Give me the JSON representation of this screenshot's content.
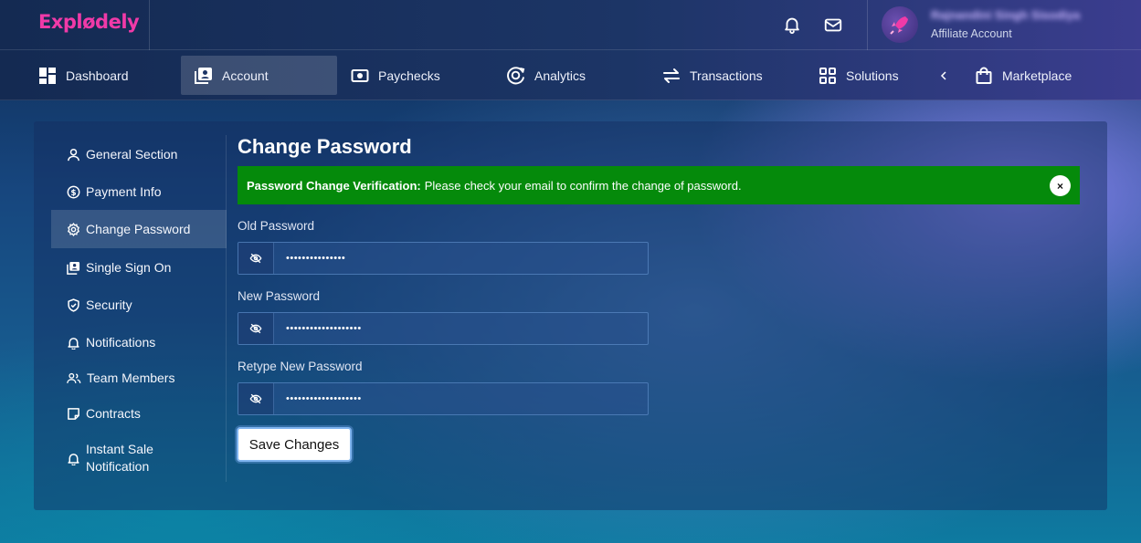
{
  "header": {
    "logo": "Explødely",
    "user_name": "Rajnandini Singh Sisodiya",
    "user_role": "Affiliate Account",
    "icons": [
      "bell-icon",
      "mail-icon",
      "rocket-avatar"
    ]
  },
  "nav": {
    "items": [
      {
        "label": "Dashboard",
        "icon": "dashboard-icon"
      },
      {
        "label": "Account",
        "icon": "account-icon",
        "active": true
      },
      {
        "label": "Paychecks",
        "icon": "paychecks-icon"
      },
      {
        "label": "Analytics",
        "icon": "analytics-icon"
      },
      {
        "label": "Transactions",
        "icon": "transactions-icon"
      },
      {
        "label": "Solutions",
        "icon": "solutions-icon"
      },
      {
        "label": "Marketplace",
        "icon": "marketplace-icon"
      }
    ],
    "back_icon": "chevron-left-icon"
  },
  "sidebar": {
    "items": [
      {
        "label": "General Section",
        "icon": "user-icon"
      },
      {
        "label": "Payment Info",
        "icon": "dollar-circle-icon"
      },
      {
        "label": "Change Password",
        "icon": "gear-icon",
        "active": true
      },
      {
        "label": "Single Sign On",
        "icon": "id-card-icon"
      },
      {
        "label": "Security",
        "icon": "shield-icon"
      },
      {
        "label": "Notifications",
        "icon": "bell-icon"
      },
      {
        "label": "Team Members",
        "icon": "team-icon"
      },
      {
        "label": "Contracts",
        "icon": "note-icon"
      },
      {
        "label": "Instant Sale Notification",
        "label_line1": "Instant Sale",
        "label_line2": "Notification",
        "icon": "bell-icon"
      }
    ]
  },
  "main": {
    "title": "Change Password",
    "alert": {
      "title": "Password Change Verification:",
      "message": "Please check your email to confirm the change of password.",
      "color": "#058a0b"
    },
    "fields": [
      {
        "label": "Old Password",
        "value": "•••••••••••••••"
      },
      {
        "label": "New Password",
        "value": "•••••••••••••••••••"
      },
      {
        "label": "Retype New Password",
        "value": "•••••••••••••••••••"
      }
    ],
    "save_label": "Save Changes"
  },
  "colors": {
    "brand": "#f03aa8",
    "alert_green": "#058a0b",
    "accent_blue": "#7fb4ef"
  }
}
